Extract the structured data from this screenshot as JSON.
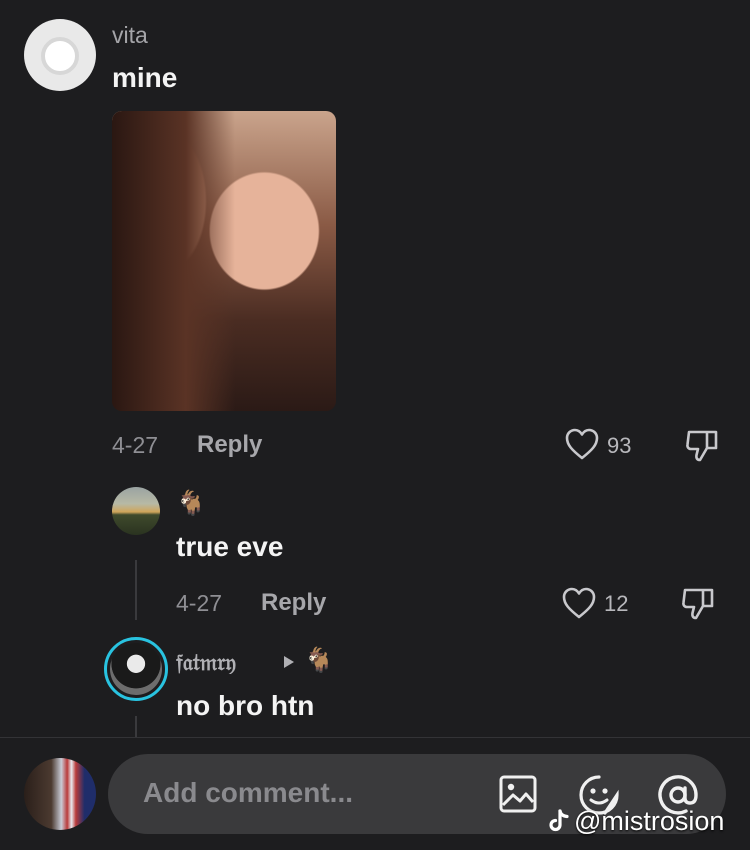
{
  "comments": [
    {
      "username": "vita",
      "text": "mine",
      "date": "4-27",
      "reply_label": "Reply",
      "likes": "93"
    },
    {
      "username_emoji": "🐐",
      "text": "true eve",
      "date": "4-27",
      "reply_label": "Reply",
      "likes": "12"
    },
    {
      "username": "𝔣𝔞𝔱𝔪𝔯𝔶",
      "reply_to_emoji": "🐐",
      "text": "no bro htn"
    }
  ],
  "composer": {
    "placeholder": "Add comment..."
  },
  "watermark": {
    "text": "@mistrosion"
  },
  "icons": {
    "like": "heart-icon",
    "dislike": "thumbs-down-icon",
    "image": "image-icon",
    "emoji": "emoji-icon",
    "mention": "at-icon",
    "brand": "tiktok-logo-icon"
  }
}
